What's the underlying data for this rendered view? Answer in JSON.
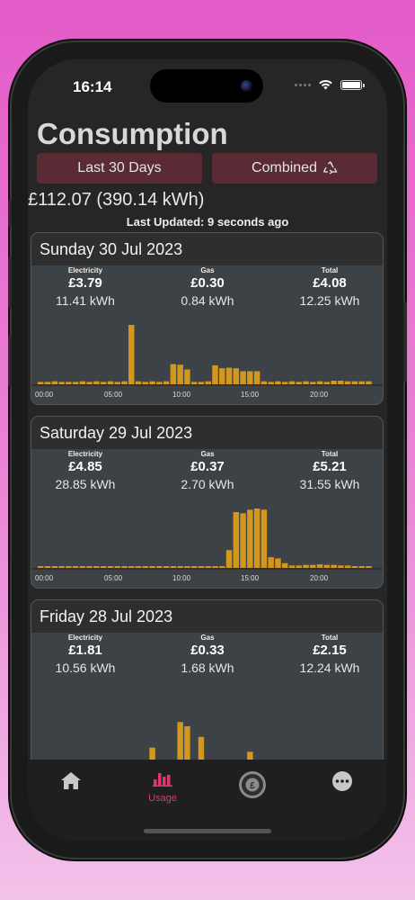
{
  "status": {
    "time": "16:14"
  },
  "page": {
    "title": "Consumption",
    "period_button": "Last 30 Days",
    "mode_button": "Combined",
    "mode_icon": "recycle-icon",
    "total": "£112.07 (390.14 kWh)",
    "last_updated": "Last Updated: 9 seconds ago"
  },
  "labels": {
    "electricity": "Electricity",
    "gas": "Gas",
    "total": "Total"
  },
  "colors": {
    "bar": "#d4971e",
    "accent": "#e0366b",
    "button_bg": "#5a2b35"
  },
  "x_ticks": [
    "00:00",
    "05:00",
    "10:00",
    "15:00",
    "20:00"
  ],
  "days": [
    {
      "date": "Sunday 30 Jul 2023",
      "electricity": {
        "cost": "£3.79",
        "kwh": "11.41 kWh"
      },
      "gas": {
        "cost": "£0.30",
        "kwh": "0.84 kWh"
      },
      "total": {
        "cost": "£4.08",
        "kwh": "12.25 kWh"
      },
      "chart_data": {
        "type": "bar",
        "x_ticks": [
          "00:00",
          "05:00",
          "10:00",
          "15:00",
          "20:00"
        ],
        "values": [
          0.04,
          0.04,
          0.05,
          0.04,
          0.04,
          0.04,
          0.05,
          0.04,
          0.05,
          0.04,
          0.05,
          0.04,
          0.05,
          1.0,
          0.05,
          0.04,
          0.05,
          0.04,
          0.05,
          0.34,
          0.33,
          0.25,
          0.04,
          0.04,
          0.05,
          0.32,
          0.27,
          0.28,
          0.27,
          0.22,
          0.22,
          0.22,
          0.05,
          0.04,
          0.05,
          0.04,
          0.05,
          0.04,
          0.05,
          0.04,
          0.05,
          0.04,
          0.06,
          0.06,
          0.05,
          0.05,
          0.05,
          0.05
        ]
      }
    },
    {
      "date": "Saturday 29 Jul 2023",
      "electricity": {
        "cost": "£4.85",
        "kwh": "28.85 kWh"
      },
      "gas": {
        "cost": "£0.37",
        "kwh": "2.70 kWh"
      },
      "total": {
        "cost": "£5.21",
        "kwh": "31.55 kWh"
      },
      "chart_data": {
        "type": "bar",
        "x_ticks": [
          "00:00",
          "05:00",
          "10:00",
          "15:00",
          "20:00"
        ],
        "values": [
          0.03,
          0.03,
          0.03,
          0.03,
          0.03,
          0.03,
          0.03,
          0.03,
          0.03,
          0.03,
          0.03,
          0.03,
          0.03,
          0.03,
          0.03,
          0.03,
          0.03,
          0.03,
          0.03,
          0.03,
          0.03,
          0.03,
          0.03,
          0.03,
          0.03,
          0.03,
          0.03,
          0.3,
          0.94,
          0.92,
          0.98,
          1.0,
          0.98,
          0.18,
          0.16,
          0.08,
          0.04,
          0.04,
          0.05,
          0.05,
          0.06,
          0.05,
          0.05,
          0.04,
          0.04,
          0.03,
          0.03,
          0.03
        ]
      }
    },
    {
      "date": "Friday 28 Jul 2023",
      "electricity": {
        "cost": "£1.81",
        "kwh": "10.56 kWh"
      },
      "gas": {
        "cost": "£0.33",
        "kwh": "1.68 kWh"
      },
      "total": {
        "cost": "£2.15",
        "kwh": "12.24 kWh"
      },
      "chart_data": {
        "type": "bar",
        "x_ticks": [
          "00:00",
          "05:00",
          "10:00",
          "15:00",
          "20:00"
        ],
        "values": [
          0.08,
          0.08,
          0.09,
          0.08,
          0.1,
          0.09,
          0.12,
          0.1,
          0.1,
          0.09,
          0.08,
          0.08,
          0.09,
          0.09,
          0.14,
          0.2,
          0.52,
          0.18,
          0.18,
          0.16,
          0.95,
          0.88,
          0.2,
          0.7,
          0.14,
          0.13,
          0.14,
          0.14,
          0.16,
          0.3,
          0.45,
          0.16,
          0.17,
          0.17,
          0.2,
          0.18,
          0.16,
          0.2,
          0.13,
          0.16,
          0.14,
          0.13,
          0.16,
          0.15,
          0.14,
          0.13,
          0.11,
          0.11
        ]
      }
    }
  ],
  "tabs": [
    {
      "icon": "home-icon",
      "label": ""
    },
    {
      "icon": "bar-chart-icon",
      "label": "Usage"
    },
    {
      "icon": "pound-coin-icon",
      "label": ""
    },
    {
      "icon": "more-icon",
      "label": ""
    }
  ]
}
